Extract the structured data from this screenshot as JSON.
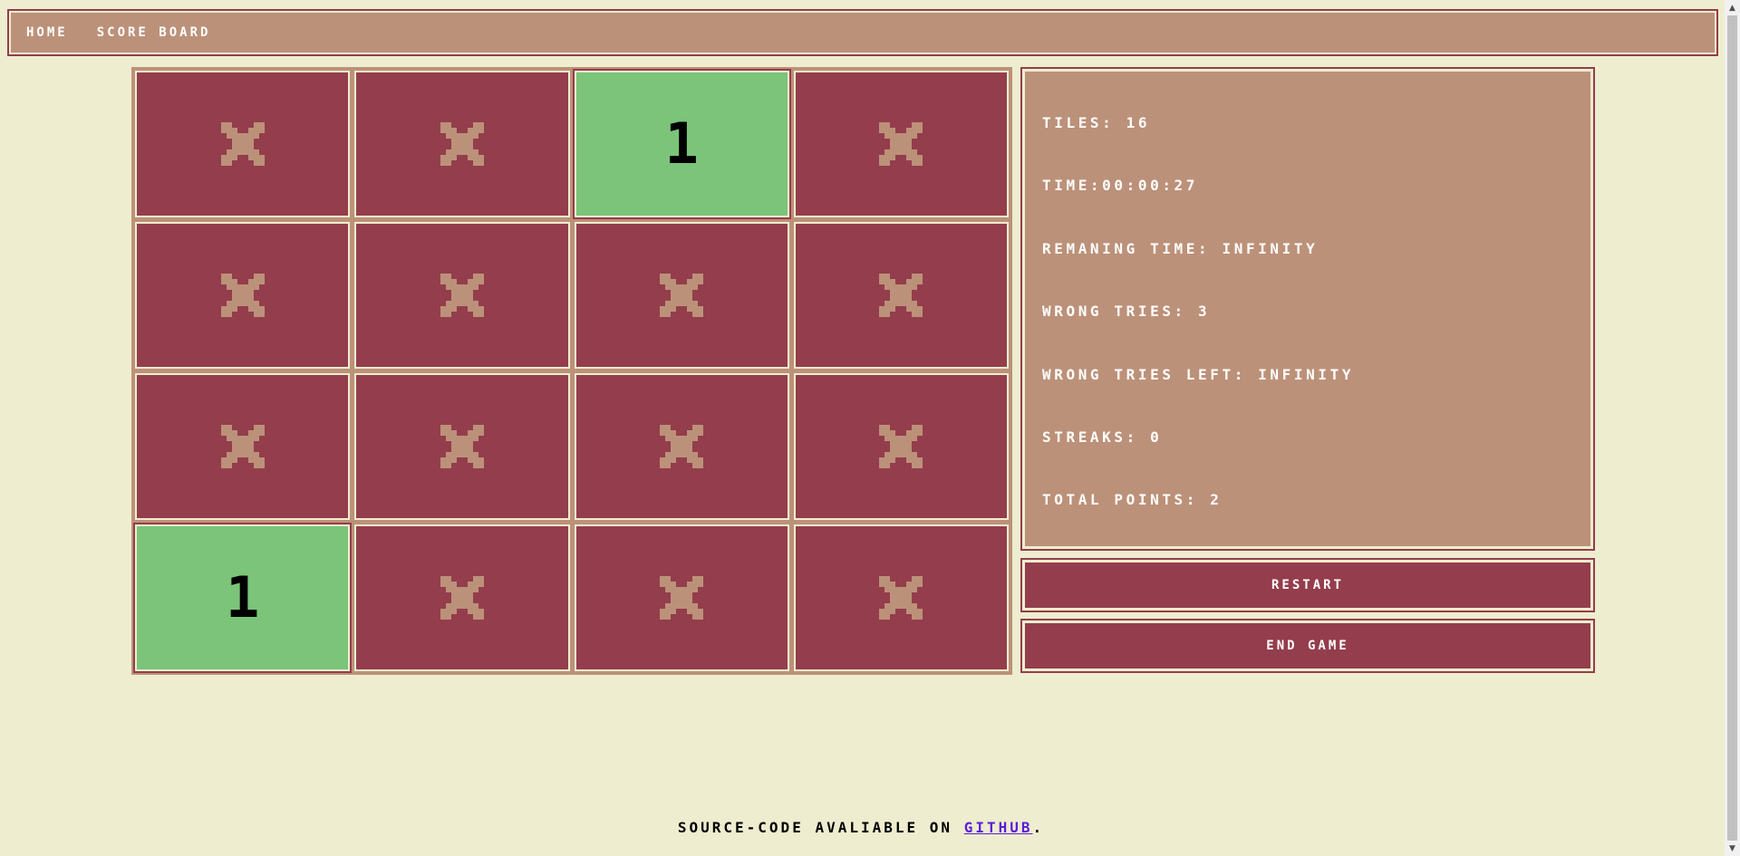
{
  "colors": {
    "background": "#eeedcf",
    "panel": "#bc9179",
    "tile_hidden": "#943d4c",
    "tile_revealed": "#7bc47a",
    "link": "#5a1fd6"
  },
  "nav": {
    "home": "HOME",
    "scoreboard": "SCORE BOARD"
  },
  "board": {
    "tiles": [
      {
        "state": "hidden",
        "icon": "x-icon",
        "value": ""
      },
      {
        "state": "hidden",
        "icon": "x-icon",
        "value": ""
      },
      {
        "state": "revealed",
        "icon": "",
        "value": "1"
      },
      {
        "state": "hidden",
        "icon": "x-icon",
        "value": ""
      },
      {
        "state": "hidden",
        "icon": "x-icon",
        "value": ""
      },
      {
        "state": "hidden",
        "icon": "x-icon",
        "value": ""
      },
      {
        "state": "hidden",
        "icon": "x-icon",
        "value": ""
      },
      {
        "state": "hidden",
        "icon": "x-icon",
        "value": ""
      },
      {
        "state": "hidden",
        "icon": "x-icon",
        "value": ""
      },
      {
        "state": "hidden",
        "icon": "x-icon",
        "value": ""
      },
      {
        "state": "hidden",
        "icon": "x-icon",
        "value": ""
      },
      {
        "state": "hidden",
        "icon": "x-icon",
        "value": ""
      },
      {
        "state": "revealed",
        "icon": "",
        "value": "1"
      },
      {
        "state": "hidden",
        "icon": "x-icon",
        "value": ""
      },
      {
        "state": "hidden",
        "icon": "x-icon",
        "value": ""
      },
      {
        "state": "hidden",
        "icon": "x-icon",
        "value": ""
      }
    ]
  },
  "stats": {
    "tiles": "TILES: 16",
    "time": "TIME:00:00:27",
    "remaining_time": "REMANING TIME: INFINITY",
    "wrong_tries": "WRONG TRIES: 3",
    "wrong_tries_left": "WRONG TRIES LEFT: INFINITY",
    "streaks": "STREAKS: 0",
    "total_points": "TOTAL POINTS: 2"
  },
  "buttons": {
    "restart": "RESTART",
    "end_game": "END GAME"
  },
  "footer": {
    "text": "SOURCE-CODE AVALIABLE ON ",
    "link": "GITHUB",
    "suffix": "."
  }
}
